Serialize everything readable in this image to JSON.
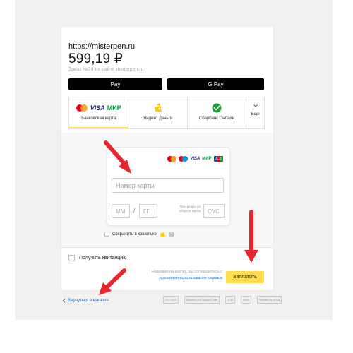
{
  "order": {
    "site_url": "https://misterpen.ru",
    "amount": "599,19 ₽",
    "description": "Заказ №24 на сайте misterpen.ru"
  },
  "quick_pay": {
    "apple_pay_label": " Pay",
    "google_pay_label": "G Pay"
  },
  "methods": [
    {
      "label": "Банковская карта",
      "icon": "bank-card-logos",
      "selected": true
    },
    {
      "label": "Яндекс.Деньги",
      "icon": "yandex-money-icon",
      "selected": false
    },
    {
      "label": "Сбербанк Онлайн",
      "icon": "sberbank-icon",
      "selected": false
    },
    {
      "label": "Еще",
      "icon": "chevron-down-icon",
      "selected": false
    }
  ],
  "card_brands": {
    "visa": "VISA",
    "mir": "МИР",
    "jcb": "JCB"
  },
  "card_form": {
    "number_placeholder": "Номер карты",
    "month_placeholder": "ММ",
    "year_placeholder": "ГГ",
    "separator": "/",
    "cvc_hint": "Три цифры на обороте карты",
    "cvc_placeholder": "CVC"
  },
  "save_wallet": {
    "label": "Сохранить в кошельке",
    "help": "?"
  },
  "receipt": {
    "label": "Получить квитанцию"
  },
  "consent": {
    "text": "Нажимая на кнопку, вы соглашаетесь с",
    "link": "условиями использования сервиса"
  },
  "submit": {
    "label": "Заплатить"
  },
  "footer": {
    "back_label": "Вернуться в магазин",
    "logos": [
      "PCI DSS",
      "MasterCard SecureCode",
      "JCB",
      "VISA",
      "Verified by VISA"
    ]
  },
  "colors": {
    "accent_yellow": "#ffdb4d",
    "link_blue": "#1a6fc1",
    "arrow_red": "#e8262f",
    "sber_green": "#21a038",
    "mastercard_red": "#eb001b",
    "mastercard_orange": "#f79e1b"
  }
}
